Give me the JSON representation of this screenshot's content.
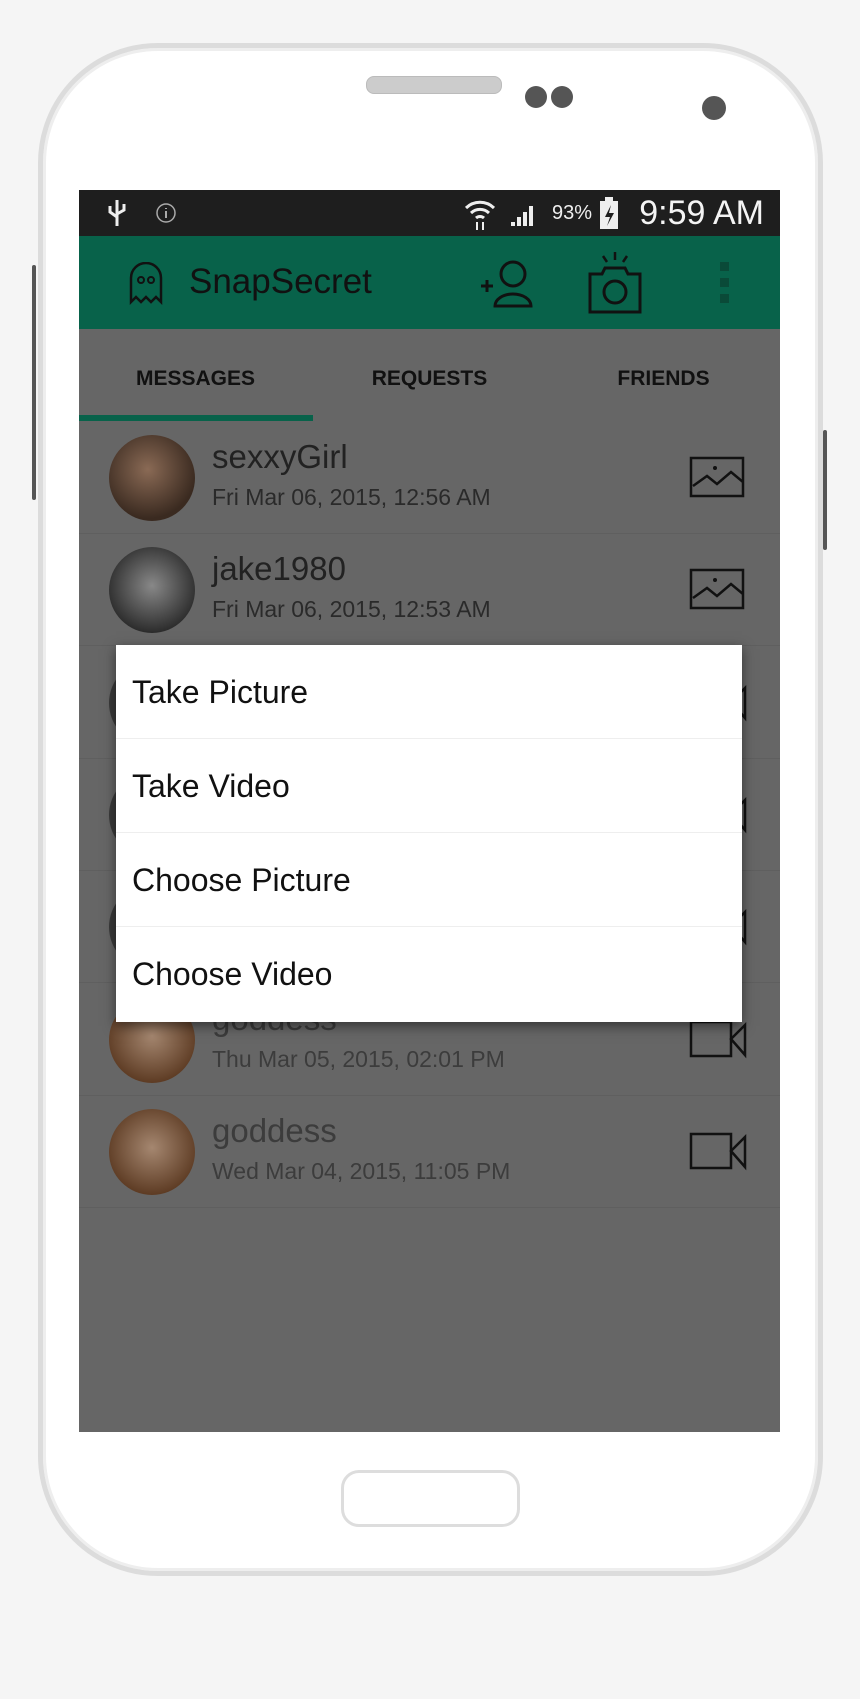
{
  "status_bar": {
    "battery": "93%",
    "time": "9:59 AM",
    "icons": [
      "usb-icon",
      "info-icon",
      "wifi-icon",
      "signal-icon",
      "battery-charging-icon"
    ]
  },
  "toolbar": {
    "title": "SnapSecret",
    "icons": [
      "ghost-logo-icon",
      "add-friend-icon",
      "camera-icon",
      "overflow-menu-icon"
    ],
    "color": "#08624a"
  },
  "tabs": [
    {
      "label": "MESSAGES",
      "active": true
    },
    {
      "label": "REQUESTS"
    },
    {
      "label": "FRIENDS"
    }
  ],
  "messages": [
    {
      "name": "sexxyGirl",
      "date": "Fri Mar 06, 2015, 12:56 AM",
      "type": "image-icon"
    },
    {
      "name": "jake1980",
      "date": "Fri Mar 06, 2015, 12:53 AM",
      "type": "image-icon"
    },
    {
      "type": "video-icon"
    },
    {
      "type": "video-icon"
    },
    {
      "type": "video-icon"
    },
    {
      "name": "goddess",
      "date": "Thu Mar 05, 2015, 02:01 PM",
      "type": "video-icon"
    },
    {
      "name": "goddess",
      "date": "Wed Mar 04, 2015, 11:05 PM",
      "type": "video-icon"
    }
  ],
  "dialog": {
    "items": [
      "Take Picture",
      "Take Video",
      "Choose Picture",
      "Choose Video"
    ]
  }
}
